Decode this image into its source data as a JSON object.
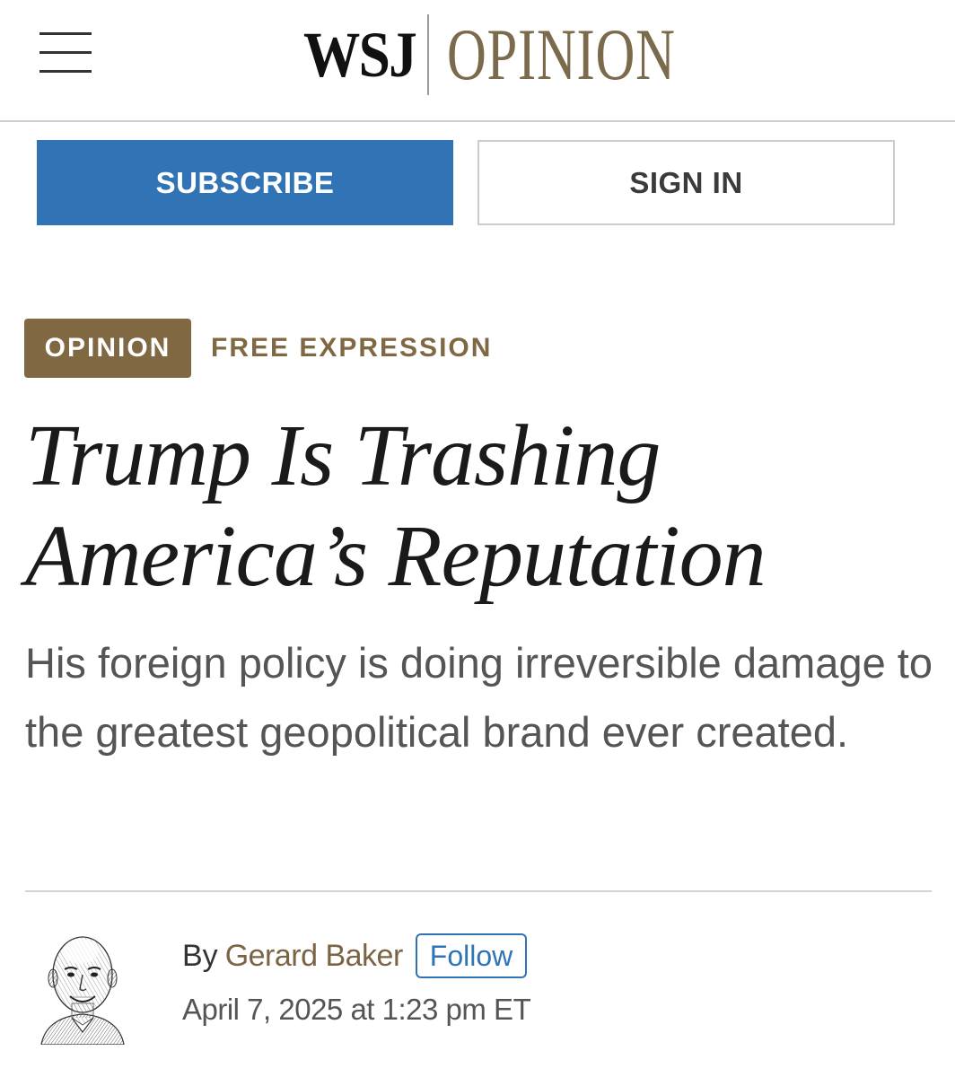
{
  "header": {
    "menu_icon": "hamburger-menu-icon",
    "logo_brand": "WSJ",
    "logo_section": "OPINION"
  },
  "auth": {
    "subscribe_label": "SUBSCRIBE",
    "signin_label": "SIGN IN"
  },
  "article": {
    "section_tag": "OPINION",
    "category": "FREE EXPRESSION",
    "headline_line1": "Trump Is Trashing",
    "headline_line2": "America’s Reputation",
    "dek": "His foreign policy is doing irreversible damage to the greatest geopolitical brand ever created.",
    "byline_prefix": "By",
    "author": "Gerard Baker",
    "follow_label": "Follow",
    "timestamp": "April 7, 2025 at 1:23 pm ET"
  },
  "colors": {
    "subscribe_bg": "#3174b6",
    "opinion_brown": "#806843",
    "logo_gold": "#7c6a4c",
    "follow_blue": "#3174b6"
  }
}
